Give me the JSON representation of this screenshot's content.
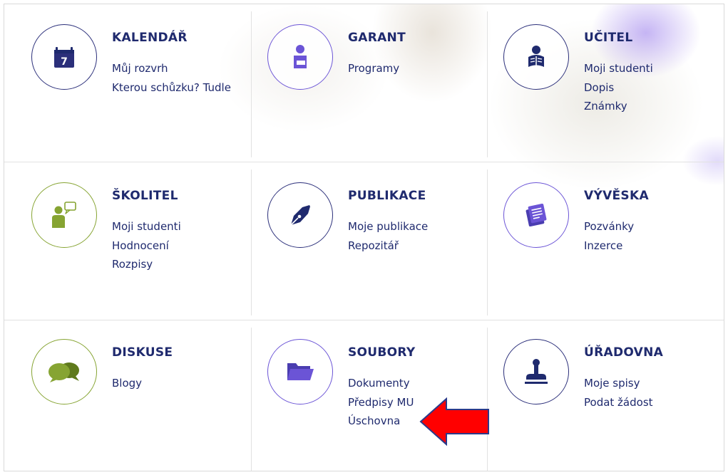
{
  "colors": {
    "navy": "#1f2a6e",
    "purple": "#6b54d6",
    "green": "#86a432",
    "arrow_red": "#ff0000"
  },
  "tiles": [
    {
      "title": "KALENDÁŘ",
      "icon": "calendar-icon",
      "icon_text": "7",
      "links": [
        "Můj rozvrh",
        "Kterou schůzku? Tudle"
      ]
    },
    {
      "title": "GARANT",
      "icon": "person-with-document-icon",
      "links": [
        "Programy"
      ]
    },
    {
      "title": "UČITEL",
      "icon": "teacher-reading-icon",
      "links": [
        "Moji studenti",
        "Dopis",
        "Známky"
      ]
    },
    {
      "title": "ŠKOLITEL",
      "icon": "supervisor-speech-icon",
      "links": [
        "Moji studenti",
        "Hodnocení",
        "Rozpisy"
      ]
    },
    {
      "title": "PUBLIKACE",
      "icon": "pen-nib-icon",
      "links": [
        "Moje publikace",
        "Repozitář"
      ]
    },
    {
      "title": "VÝVĚSKA",
      "icon": "notice-board-icon",
      "links": [
        "Pozvánky",
        "Inzerce"
      ]
    },
    {
      "title": "DISKUSE",
      "icon": "chat-bubbles-icon",
      "links": [
        "Blogy"
      ]
    },
    {
      "title": "SOUBORY",
      "icon": "folder-icon",
      "links": [
        "Dokumenty",
        "Předpisy MU",
        "Úschovna"
      ]
    },
    {
      "title": "ÚŘADOVNA",
      "icon": "stamp-icon",
      "links": [
        "Moje spisy",
        "Podat žádost"
      ]
    }
  ]
}
